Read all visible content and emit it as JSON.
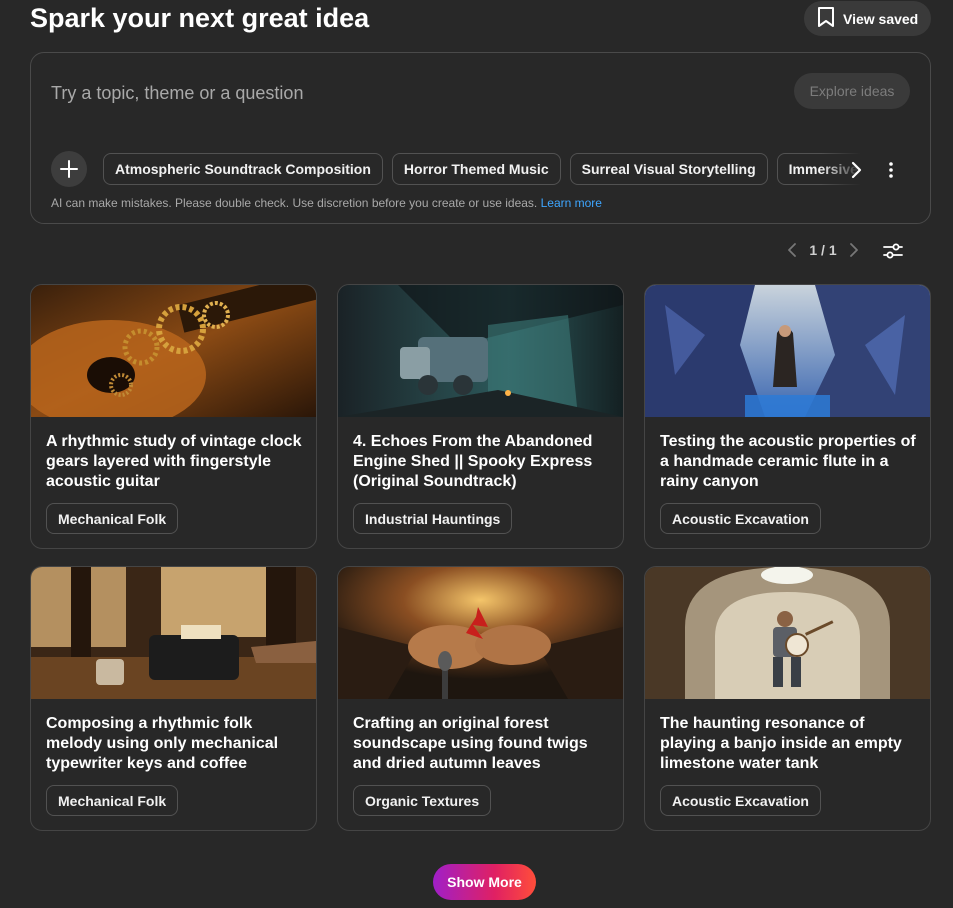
{
  "header": {
    "title": "Spark your next great idea",
    "view_saved_label": "View saved"
  },
  "prompt": {
    "placeholder": "Try a topic, theme or a question",
    "value": "",
    "explore_label": "Explore ideas",
    "chips": [
      "Atmospheric Soundtrack Composition",
      "Horror Themed Music",
      "Surreal Visual Storytelling",
      "Immersive Sound Design"
    ],
    "disclaimer": "AI can make mistakes. Please double check. Use discretion before you create or use ideas.",
    "learn_more": "Learn more"
  },
  "pager": {
    "label": "1 / 1"
  },
  "cards": [
    {
      "title": "A rhythmic study of vintage clock gears layered with fingerstyle acoustic guitar",
      "tag": "Mechanical Folk"
    },
    {
      "title": "4. Echoes From the Abandoned Engine Shed || Spooky Express (Original Soundtrack)",
      "tag": "Industrial Hauntings"
    },
    {
      "title": "Testing the acoustic properties of a handmade ceramic flute in a rainy canyon",
      "tag": "Acoustic Excavation"
    },
    {
      "title": "Composing a rhythmic folk melody using only mechanical typewriter keys and coffee",
      "tag": "Mechanical Folk"
    },
    {
      "title": "Crafting an original forest soundscape using found twigs and dried autumn leaves",
      "tag": "Organic Textures"
    },
    {
      "title": "The haunting resonance of playing a banjo inside an empty limestone water tank",
      "tag": "Acoustic Excavation"
    }
  ],
  "show_more_label": "Show More",
  "colors": {
    "background": "#282828",
    "link": "#3ea6ff",
    "show_more_gradient": [
      "#a01fc8",
      "#e02063",
      "#ff4e3a"
    ]
  },
  "icons": {
    "view_saved": "bookmark-icon",
    "add": "plus-icon",
    "chips_next": "chevron-right-icon",
    "chips_more": "more-vertical-icon",
    "pager_prev": "chevron-left-icon",
    "pager_next": "chevron-right-icon",
    "filter": "sliders-icon"
  }
}
